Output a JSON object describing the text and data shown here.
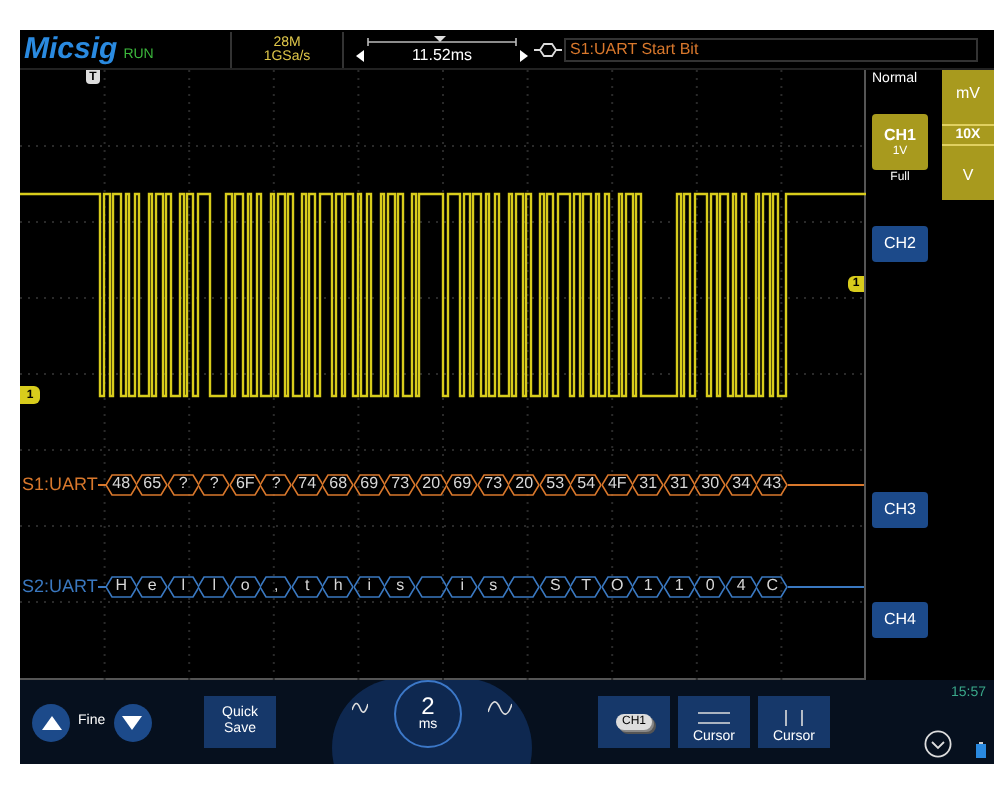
{
  "header": {
    "brand": "Micsig",
    "run_state": "RUN",
    "memory_depth": "28M",
    "sample_rate": "1GSa/s",
    "time_offset": "11.52ms",
    "trigger_source": "S1:UART Start Bit"
  },
  "trigger_position_marker": "T",
  "ground_marker": "1",
  "trigger_level_marker": "1",
  "trigger_mode": "Normal",
  "units": [
    {
      "label": "mV",
      "selected": false
    },
    {
      "label": "10X",
      "selected": true
    },
    {
      "label": "V",
      "selected": false
    }
  ],
  "channels": [
    {
      "label": "CH1",
      "kind": "analog",
      "selected": true,
      "scale": "1V",
      "bandwidth": "Full"
    },
    {
      "label": "CH2",
      "kind": "analog",
      "selected": false
    },
    {
      "label": "CH3",
      "kind": "analog",
      "selected": false
    },
    {
      "label": "CH4",
      "kind": "analog",
      "selected": false
    }
  ],
  "decodes": [
    {
      "label": "S1:UART",
      "color": "#d9782c",
      "frames": [
        {
          "kind": "byte",
          "text": "48"
        },
        {
          "kind": "byte",
          "text": "65"
        },
        {
          "kind": "byte",
          "text": "?"
        },
        {
          "kind": "byte",
          "text": "?"
        },
        {
          "kind": "byte",
          "text": "6F"
        },
        {
          "kind": "byte",
          "text": "?"
        },
        {
          "kind": "byte",
          "text": "74"
        },
        {
          "kind": "byte",
          "text": "68"
        },
        {
          "kind": "byte",
          "text": "69"
        },
        {
          "kind": "byte",
          "text": "73"
        },
        {
          "kind": "byte",
          "text": "20"
        },
        {
          "kind": "byte",
          "text": "69"
        },
        {
          "kind": "byte",
          "text": "73"
        },
        {
          "kind": "byte",
          "text": "20"
        },
        {
          "kind": "byte",
          "text": "53"
        },
        {
          "kind": "byte",
          "text": "54"
        },
        {
          "kind": "byte",
          "text": "4F"
        },
        {
          "kind": "byte",
          "text": "31"
        },
        {
          "kind": "byte",
          "text": "31"
        },
        {
          "kind": "byte",
          "text": "30"
        },
        {
          "kind": "byte",
          "text": "34"
        },
        {
          "kind": "byte",
          "text": "43"
        }
      ]
    },
    {
      "label": "S2:UART",
      "color": "#3a78c0",
      "frames": [
        {
          "kind": "byte",
          "text": "H"
        },
        {
          "kind": "byte",
          "text": "e"
        },
        {
          "kind": "byte",
          "text": "l"
        },
        {
          "kind": "byte",
          "text": "l"
        },
        {
          "kind": "byte",
          "text": "o"
        },
        {
          "kind": "byte",
          "text": ","
        },
        {
          "kind": "byte",
          "text": "t"
        },
        {
          "kind": "byte",
          "text": "h"
        },
        {
          "kind": "byte",
          "text": "i"
        },
        {
          "kind": "byte",
          "text": "s"
        },
        {
          "kind": "blank"
        },
        {
          "kind": "byte",
          "text": "i"
        },
        {
          "kind": "byte",
          "text": "s"
        },
        {
          "kind": "blank"
        },
        {
          "kind": "byte",
          "text": "S"
        },
        {
          "kind": "byte",
          "text": "T"
        },
        {
          "kind": "byte",
          "text": "O"
        },
        {
          "kind": "byte",
          "text": "1"
        },
        {
          "kind": "byte",
          "text": "1"
        },
        {
          "kind": "byte",
          "text": "0"
        },
        {
          "kind": "byte",
          "text": "4"
        },
        {
          "kind": "byte",
          "text": "C"
        }
      ]
    }
  ],
  "bottom_bar": {
    "fine_label": "Fine",
    "quick_save": "Quick Save",
    "timebase_value": "2",
    "timebase_unit": "ms",
    "channel_chip": "CH1",
    "cursor_horizontal": "Cursor",
    "cursor_vertical": "Cursor",
    "clock": "15:57"
  }
}
